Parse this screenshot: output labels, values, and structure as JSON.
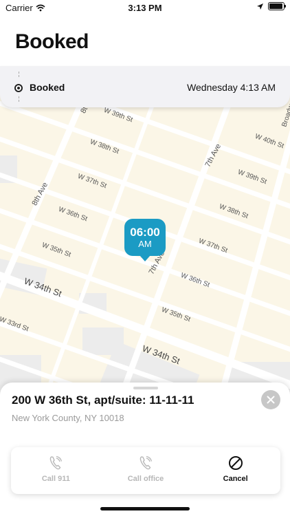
{
  "status_bar": {
    "carrier": "Carrier",
    "time": "3:13 PM",
    "battery_level": 0.95
  },
  "header": {
    "title": "Booked"
  },
  "booking": {
    "label": "Booked",
    "datetime": "Wednesday 4:13 AM"
  },
  "map": {
    "pin_time": "06:00",
    "pin_ampm": "AM",
    "streets": {
      "w39": "W 39th St",
      "w38a": "W 38th St",
      "w37a": "W 37th St",
      "w36a": "W 36th St",
      "w35a": "W 35th St",
      "w34a": "W 34th St",
      "w40": "W 40th St",
      "w39b": "W 39th St",
      "w38b": "W 38th St",
      "w37b": "W 37th St",
      "w36b": "W 36th St",
      "w35b": "W 35th St",
      "w34b": "W 34th St",
      "w33": "W 33rd St",
      "ave7a": "7th Ave",
      "ave7b": "7th Ave",
      "ave8": "8th Ave",
      "ave8top": "8t",
      "broadway": "Broadwa"
    },
    "colors": {
      "block": "#fbf6e7",
      "road": "#ffffff",
      "pin": "#1b9bc4"
    }
  },
  "sheet": {
    "address_title": "200 W 36th St, apt/suite: 11-11-11",
    "address_sub": "New York County, NY 10018",
    "actions": [
      {
        "label": "Call 911",
        "icon": "phone-icon",
        "enabled": false
      },
      {
        "label": "Call office",
        "icon": "phone-icon",
        "enabled": false
      },
      {
        "label": "Cancel",
        "icon": "cancel-icon",
        "enabled": true
      }
    ]
  }
}
